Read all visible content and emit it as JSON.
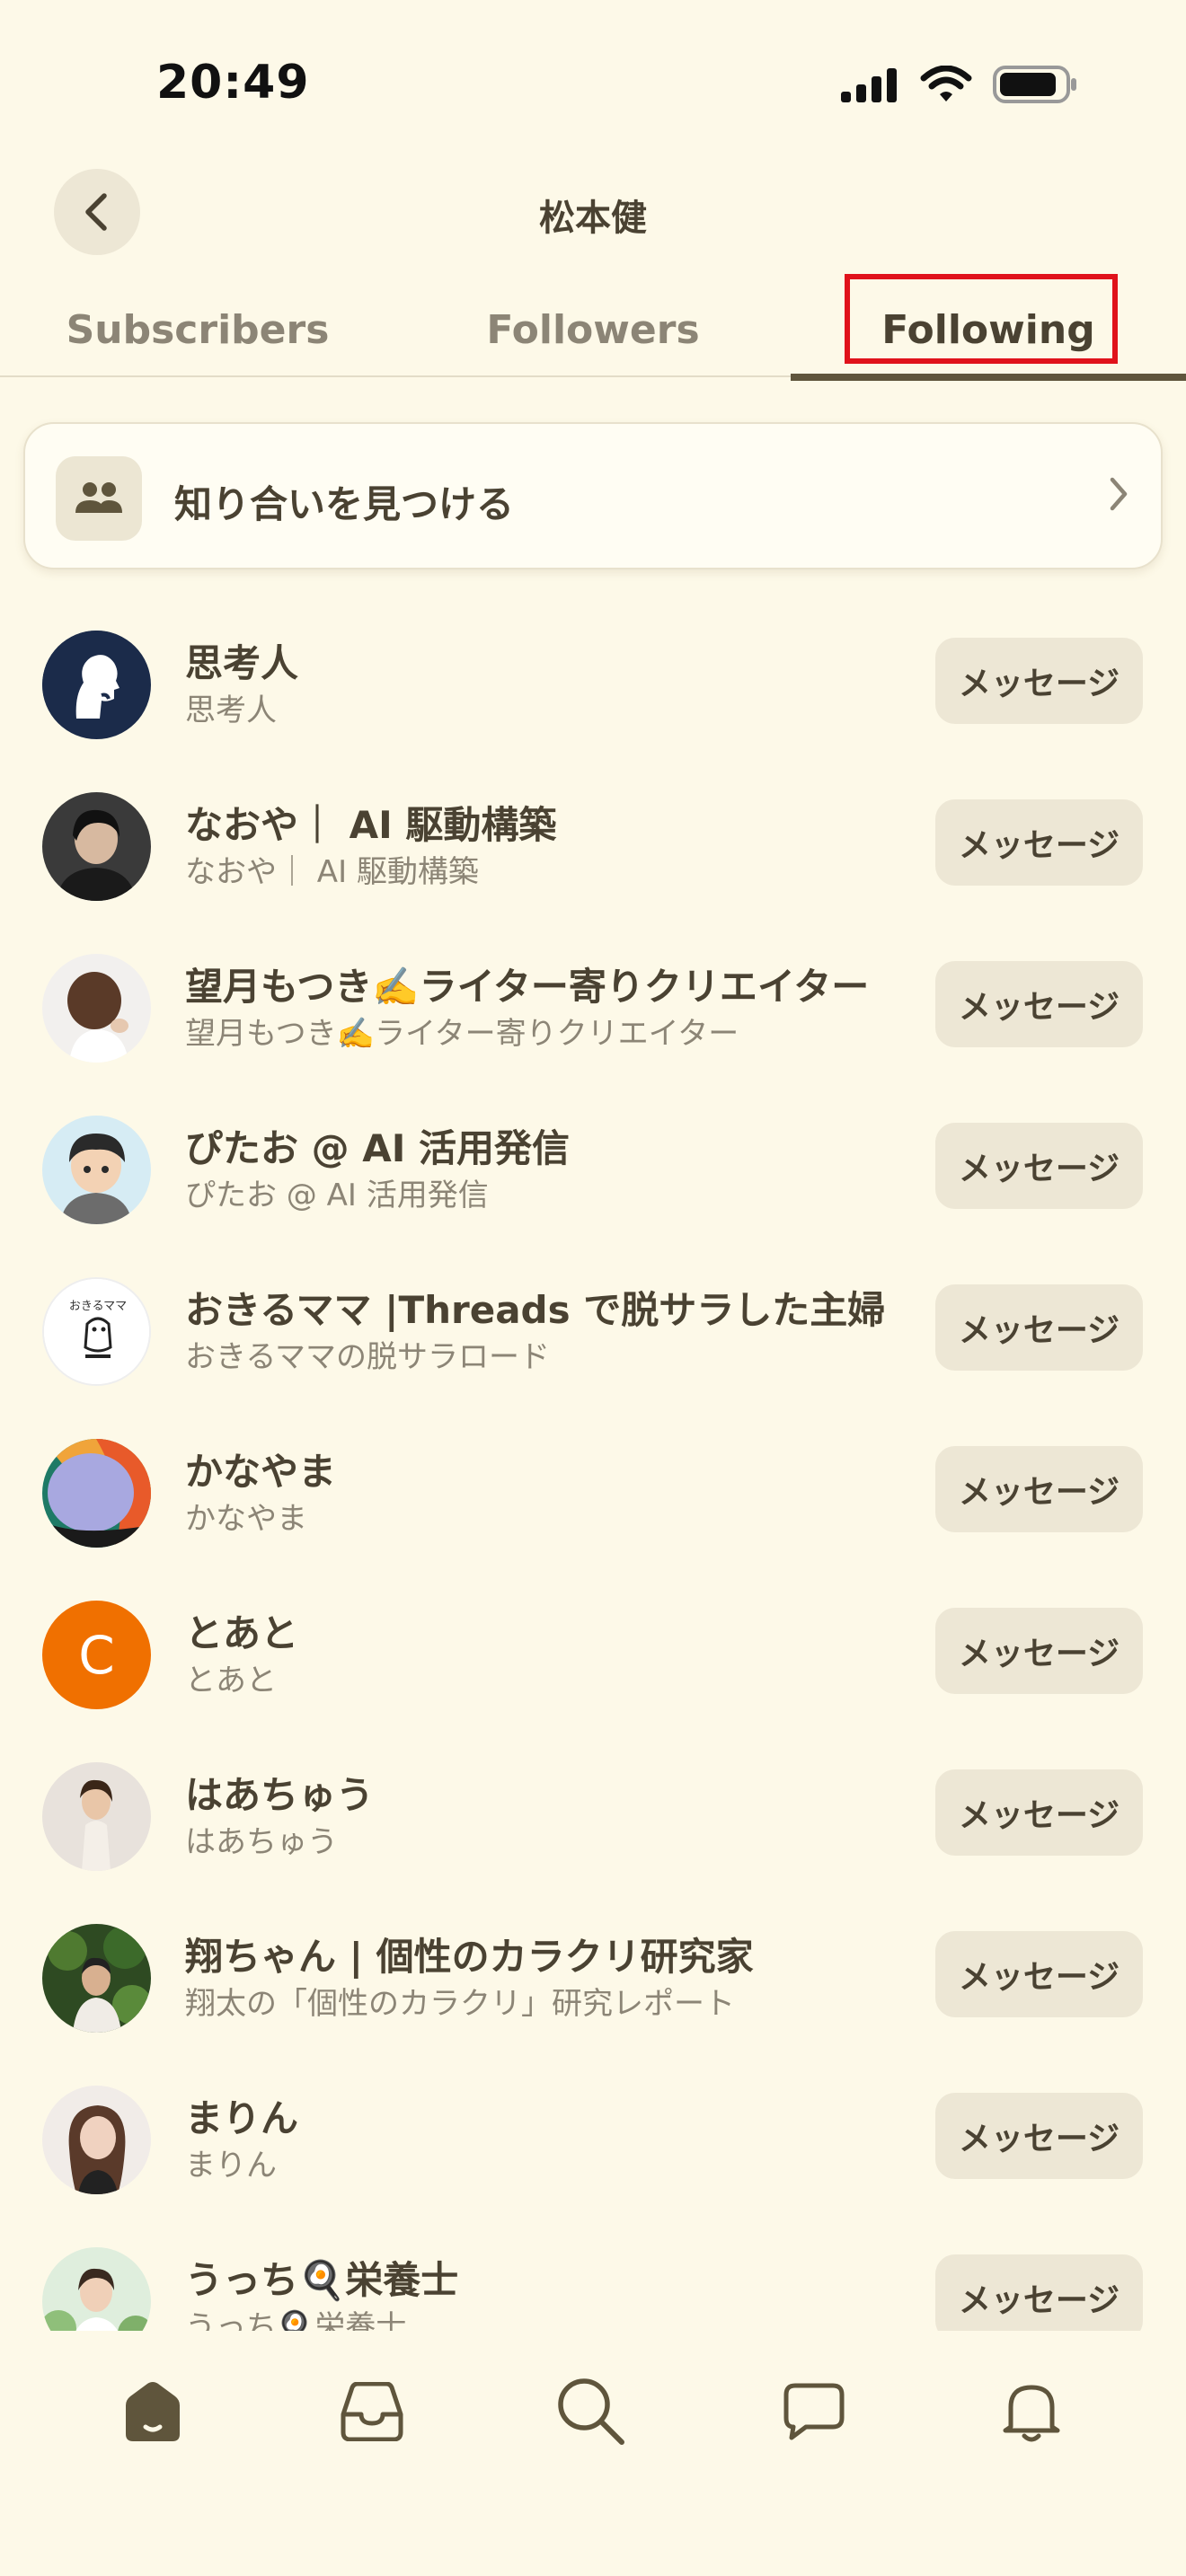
{
  "status_bar": {
    "time": "20:49"
  },
  "header": {
    "title": "松本健"
  },
  "tabs": [
    {
      "label": "Subscribers",
      "active": false
    },
    {
      "label": "Followers",
      "active": false
    },
    {
      "label": "Following",
      "active": true
    }
  ],
  "find_friends": {
    "label": "知り合いを見つける"
  },
  "list": [
    {
      "name": "思考人",
      "handle": "思考人",
      "button": "メッセージ",
      "avatar": "silhouette-thinker"
    },
    {
      "name": "なおや｜ AI 駆動構築",
      "handle": "なおや｜ AI 駆動構築",
      "button": "メッセージ",
      "avatar": "photo-man"
    },
    {
      "name": "望月もつき✍️ライター寄りクリエイター",
      "handle": "望月もつき✍️ライター寄りクリエイター",
      "button": "メッセージ",
      "avatar": "photo-woman-back"
    },
    {
      "name": "ぴたお @ AI 活用発信",
      "handle": "ぴたお @ AI 活用発信",
      "button": "メッセージ",
      "avatar": "illustration-boy"
    },
    {
      "name": "おきるママ |Threads で脱サラした主婦",
      "handle": "おきるママの脱サラロード",
      "button": "メッセージ",
      "avatar": "illustration-mama",
      "avatar_text": "おきるママ"
    },
    {
      "name": "かなやま",
      "handle": "かなやま",
      "button": "メッセージ",
      "avatar": "abstract-colors"
    },
    {
      "name": "とあと",
      "handle": "とあと",
      "button": "メッセージ",
      "avatar": "letter-c",
      "avatar_letter": "C",
      "avatar_color": "#f07000"
    },
    {
      "name": "はあちゅう",
      "handle": "はあちゅう",
      "button": "メッセージ",
      "avatar": "photo-woman"
    },
    {
      "name": "翔ちゃん | 個性のカラクリ研究家",
      "handle": "翔太の「個性のカラクリ」研究レポート",
      "button": "メッセージ",
      "avatar": "photo-nature"
    },
    {
      "name": "まりん",
      "handle": "まりん",
      "button": "メッセージ",
      "avatar": "photo-woman-2"
    },
    {
      "name": "うっち🍳栄養士",
      "handle": "うっち🍳栄養士",
      "button": "メッセージ",
      "avatar": "photo-woman-3"
    }
  ],
  "bottom_nav": [
    {
      "icon": "home-icon",
      "active": true
    },
    {
      "icon": "inbox-icon",
      "active": false
    },
    {
      "icon": "search-icon",
      "active": false
    },
    {
      "icon": "chat-icon",
      "active": false
    },
    {
      "icon": "bell-icon",
      "active": false
    }
  ],
  "colors": {
    "background": "#fdf9e8",
    "accent": "#5f553c",
    "button_bg": "#ede7d5",
    "highlight": "#e0121b"
  }
}
